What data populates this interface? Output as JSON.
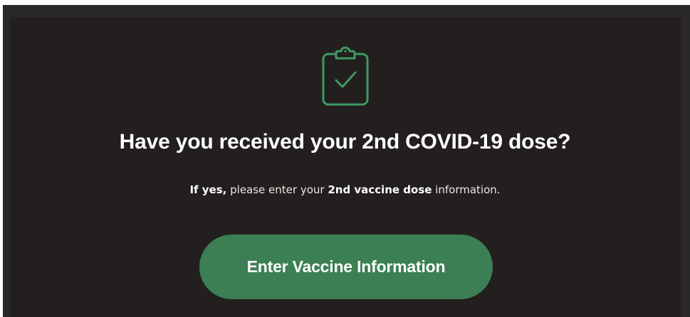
{
  "colors": {
    "card_background": "#221f1e",
    "accent_green": "#3c7f54",
    "icon_green": "#3e9a62",
    "text_primary": "#ffffff"
  },
  "prompt": {
    "icon": "clipboard-check-icon",
    "title": "Have you received your 2nd COVID-19 dose?",
    "subtitle": {
      "lead_bold": "If yes,",
      "middle": " please enter your ",
      "emphasis_bold": "2nd vaccine dose",
      "tail": " information."
    },
    "button_label": "Enter Vaccine Information"
  }
}
